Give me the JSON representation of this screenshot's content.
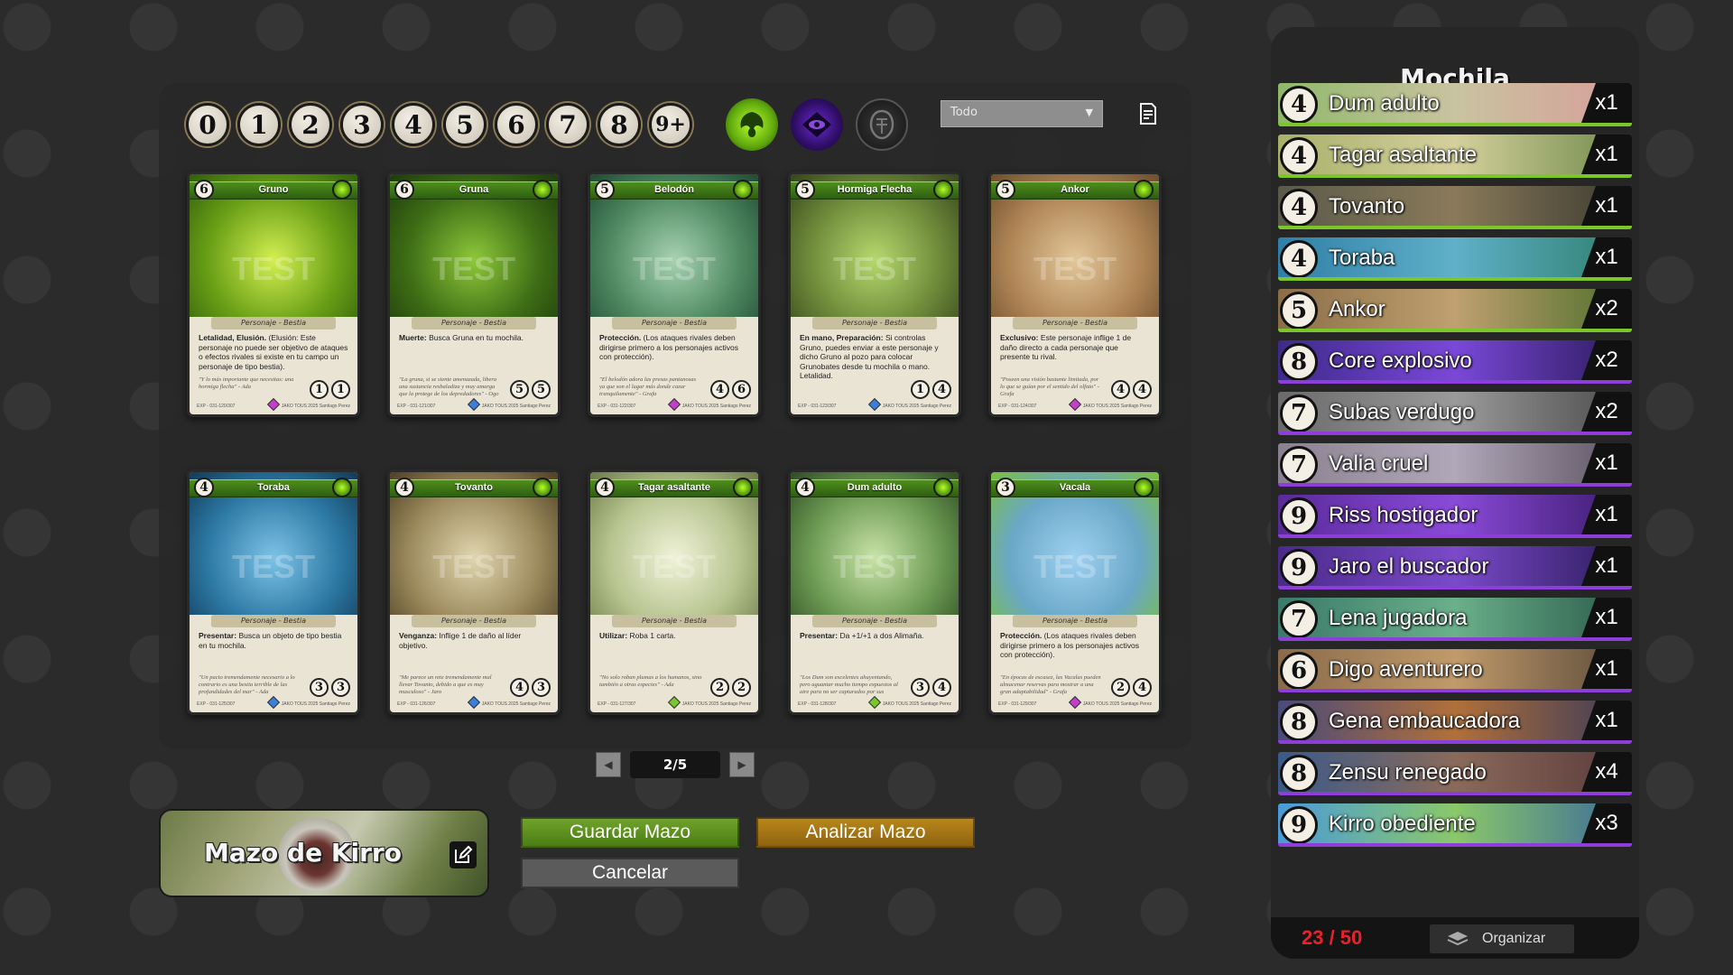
{
  "filters": {
    "costs": [
      "0",
      "1",
      "2",
      "3",
      "4",
      "5",
      "6",
      "7",
      "8",
      "9+"
    ],
    "factions": [
      {
        "name": "green-faction-icon",
        "color": "#7ed321"
      },
      {
        "name": "purple-faction-icon",
        "color": "#5a1ea8"
      },
      {
        "name": "neutral-faction-icon",
        "color": "#444444"
      }
    ],
    "type_select": "Todo"
  },
  "cards": [
    {
      "name": "Gruno",
      "cost": "6",
      "type": "Personaje - Bestia",
      "ability": "Letalidad, Elusión.",
      "text": "(Elusión: Este personaje no puede ser objetivo de ataques o efectos rivales si existe en tu campo un personaje de tipo bestia).",
      "flavor": "\"Y lo más importante que necesitas: una hormiga flecha\"  - Ada",
      "stats": [
        "1",
        "1"
      ],
      "art": [
        "#d4ef52",
        "#6aa016",
        "#2f5d0c"
      ],
      "gem": "#c23fc8",
      "watermark": "TEST",
      "set": "EXP - 031-120/307",
      "rights": "JAKO TOUS 2025 Santiago Perez"
    },
    {
      "name": "Gruna",
      "cost": "6",
      "type": "Personaje - Bestia",
      "ability": "Muerte:",
      "text": "Busca Gruna en tu mochila.",
      "flavor": "\"La gruna, si se siente amenazada, libera una sustancia resbaladiza y muy amarga que la protege de los depredadores\" - Ogo",
      "stats": [
        "5",
        "5"
      ],
      "art": [
        "#8fc83a",
        "#3f6e16",
        "#1d3a0b"
      ],
      "gem": "#3b7fd8",
      "watermark": "TEST",
      "set": "EXP - 031-121/307",
      "rights": "JAKO TOUS 2025 Santiago Perez"
    },
    {
      "name": "Belodón",
      "cost": "5",
      "type": "Personaje - Bestia",
      "ability": "Protección.",
      "text": "(Los ataques rivales deben dirigirse primero a los personajes activos con protección).",
      "flavor": "\"El belodón adora las presas pantanosas ya que son el lugar más donde cazar tranquilamente\" - Grafa",
      "stats": [
        "4",
        "6"
      ],
      "art": [
        "#a8d2b2",
        "#4f8a63",
        "#1f4a32"
      ],
      "gem": "#c23fc8",
      "watermark": "TEST",
      "set": "EXP - 031-122/307",
      "rights": "JAKO TOUS 2025 Santiago Perez"
    },
    {
      "name": "Hormiga Flecha",
      "cost": "5",
      "type": "Personaje - Bestia",
      "ability": "En mano, Preparación:",
      "text": "Si controlas Gruno, puedes enviar a este personaje y dicho Gruno al pozo para colocar Grunobates desde tu mochila o mano. Letalidad.",
      "flavor": "",
      "stats": [
        "1",
        "4"
      ],
      "art": [
        "#b6d86e",
        "#6f8b3a",
        "#35441c"
      ],
      "gem": "#3b7fd8",
      "watermark": "TEST",
      "set": "EXP - 031-123/307",
      "rights": "JAKO TOUS 2025 Santiago Perez"
    },
    {
      "name": "Ankor",
      "cost": "5",
      "type": "Personaje - Bestia",
      "ability": "Exclusivo:",
      "text": "Este personaje inflige 1 de daño directo a cada personaje que presente tu rival.",
      "flavor": "\"Poseen una visión bastante limitada, por lo que se guían por el sentido del olfato\" - Grafa",
      "stats": [
        "4",
        "4"
      ],
      "art": [
        "#e2c79a",
        "#b08657",
        "#6b4e2b"
      ],
      "gem": "#c23fc8",
      "watermark": "TEST",
      "set": "EXP - 031-124/307",
      "rights": "JAKO TOUS 2025 Santiago Perez"
    },
    {
      "name": "Toraba",
      "cost": "4",
      "type": "Personaje - Bestia",
      "ability": "Presentar:",
      "text": "Busca un objeto de tipo bestia en tu mochila.",
      "flavor": "\"Un pacto tremendamente necesario a lo contrario es una bestia terrible de las profundidades del mar\" - Ada",
      "stats": [
        "3",
        "3"
      ],
      "art": [
        "#7ec3e6",
        "#2d7aa6",
        "#123a55"
      ],
      "gem": "#3b7fd8",
      "watermark": "TEST",
      "set": "EXP - 031-125/307",
      "rights": "JAKO TOUS 2025 Santiago Perez"
    },
    {
      "name": "Tovanto",
      "cost": "4",
      "type": "Personaje - Bestia",
      "ability": "Venganza:",
      "text": "Inflige 1 de daño al líder objetivo.",
      "flavor": "\"Me parece un rete tremendamente mal llevar Tovanto, debido a que es muy musculoso\" - Jaro",
      "stats": [
        "4",
        "3"
      ],
      "art": [
        "#e0d6b0",
        "#9c8a5c",
        "#4d3f24"
      ],
      "gem": "#3b7fd8",
      "watermark": "TEST",
      "set": "EXP - 031-126/307",
      "rights": "JAKO TOUS 2025 Santiago Perez"
    },
    {
      "name": "Tagar asaltante",
      "cost": "4",
      "type": "Personaje - Bestia",
      "ability": "Utilizar:",
      "text": "Roba 1 carta.",
      "flavor": "\"No solo roban plumas a los humanos, sino también a otras especies\" - Ada",
      "stats": [
        "2",
        "2"
      ],
      "art": [
        "#f0f2d8",
        "#b7c490",
        "#6a7a46"
      ],
      "gem": "#7bc62d",
      "watermark": "TEST",
      "set": "EXP - 031-127/307",
      "rights": "JAKO TOUS 2025 Santiago Perez"
    },
    {
      "name": "Dum adulto",
      "cost": "4",
      "type": "Personaje - Bestia",
      "ability": "Presentar:",
      "text": "Da +1/+1 a dos Alimaña.",
      "flavor": "\"Los Dum son excelentes ahuyentando, pero aguantar mucho tiempo expuestos al aire para no ser capturados por sus depredadores\" - Bosa",
      "stats": [
        "3",
        "4"
      ],
      "art": [
        "#c9e3a8",
        "#6c9a53",
        "#2f4b24"
      ],
      "gem": "#7bc62d",
      "watermark": "TEST",
      "set": "EXP - 031-128/307",
      "rights": "JAKO TOUS 2025 Santiago Perez"
    },
    {
      "name": "Vacala",
      "cost": "3",
      "type": "Personaje - Bestia",
      "ability": "Protección.",
      "text": "(Los ataques rivales deben dirigirse primero a los personajes activos con protección).",
      "flavor": "\"En épocas de escasez, las Vacalas pueden almacenar reservas para mostrar a una gran adaptabilidad\" - Grafa",
      "stats": [
        "2",
        "4"
      ],
      "art": [
        "#9fd0f0",
        "#6aa8c8",
        "#7cbf3c"
      ],
      "gem": "#c23fc8",
      "watermark": "TEST",
      "set": "EXP - 031-129/307",
      "rights": "JAKO TOUS 2025 Santiago Perez"
    }
  ],
  "pagination": {
    "prev": "◀",
    "next": "▶",
    "page": "2/5"
  },
  "deck": {
    "name": "Mazo de Kirro",
    "save": "Guardar Mazo",
    "analyze": "Analizar Mazo",
    "cancel": "Cancelar"
  },
  "backpack": {
    "title": "Mochila",
    "entries": [
      {
        "cost": "4",
        "name": "Dum adulto",
        "count": "x1",
        "faction": "green",
        "art": [
          "#8fb86a",
          "#c9c3a0",
          "#d79e9a"
        ]
      },
      {
        "cost": "4",
        "name": "Tagar asaltante",
        "count": "x1",
        "faction": "green",
        "art": [
          "#a8b06a",
          "#d4d09c",
          "#6f8a4a"
        ]
      },
      {
        "cost": "4",
        "name": "Tovanto",
        "count": "x1",
        "faction": "green",
        "art": [
          "#5a5a4a",
          "#8a7a5a",
          "#3a3a30"
        ]
      },
      {
        "cost": "4",
        "name": "Toraba",
        "count": "x1",
        "faction": "green",
        "art": [
          "#2f7fa8",
          "#5fb0c8",
          "#2e7f6e"
        ]
      },
      {
        "cost": "5",
        "name": "Ankor",
        "count": "x2",
        "faction": "green",
        "art": [
          "#8a6e48",
          "#c0a070",
          "#4d6e2a"
        ]
      },
      {
        "cost": "8",
        "name": "Core explosivo",
        "count": "x2",
        "faction": "purple",
        "art": [
          "#3e2a8a",
          "#7a48d8",
          "#2a1a5a"
        ]
      },
      {
        "cost": "7",
        "name": "Subas verdugo",
        "count": "x2",
        "faction": "purple",
        "art": [
          "#6a6a6a",
          "#9a9a9a",
          "#4a4a4a"
        ]
      },
      {
        "cost": "7",
        "name": "Valia cruel",
        "count": "x1",
        "faction": "purple",
        "art": [
          "#8a8090",
          "#b0a8b8",
          "#5a5060"
        ]
      },
      {
        "cost": "9",
        "name": "Riss hostigador",
        "count": "x1",
        "faction": "purple",
        "art": [
          "#5a2a9a",
          "#8a4ad8",
          "#3a1a6a"
        ]
      },
      {
        "cost": "9",
        "name": "Jaro el buscador",
        "count": "x1",
        "faction": "purple",
        "art": [
          "#4a2a8a",
          "#7a4ac8",
          "#2a1a5a"
        ]
      },
      {
        "cost": "7",
        "name": "Lena jugadora",
        "count": "x1",
        "faction": "purple",
        "art": [
          "#3a7a6a",
          "#6ab08a",
          "#2a5a4a"
        ]
      },
      {
        "cost": "6",
        "name": "Digo aventurero",
        "count": "x1",
        "faction": "purple",
        "art": [
          "#8a6a4a",
          "#c09a6a",
          "#5a4a3a"
        ]
      },
      {
        "cost": "8",
        "name": "Gena embaucadora",
        "count": "x1",
        "faction": "purple",
        "art": [
          "#4a4a7a",
          "#b0703a",
          "#3a3a5a"
        ]
      },
      {
        "cost": "8",
        "name": "Zensu renegado",
        "count": "x4",
        "faction": "purple",
        "art": [
          "#3a5a8a",
          "#8a6a5a",
          "#5a3a3a"
        ]
      },
      {
        "cost": "9",
        "name": "Kirro obediente",
        "count": "x3",
        "faction": "purple",
        "art": [
          "#4a9ad8",
          "#8ac86a",
          "#3a6a9a"
        ]
      }
    ],
    "card_count": "23 / 50",
    "organize": "Organizar"
  },
  "colors": {
    "accent_green": "#6fa32a",
    "accent_gold": "#b8861a",
    "count_red": "#e8222a"
  }
}
